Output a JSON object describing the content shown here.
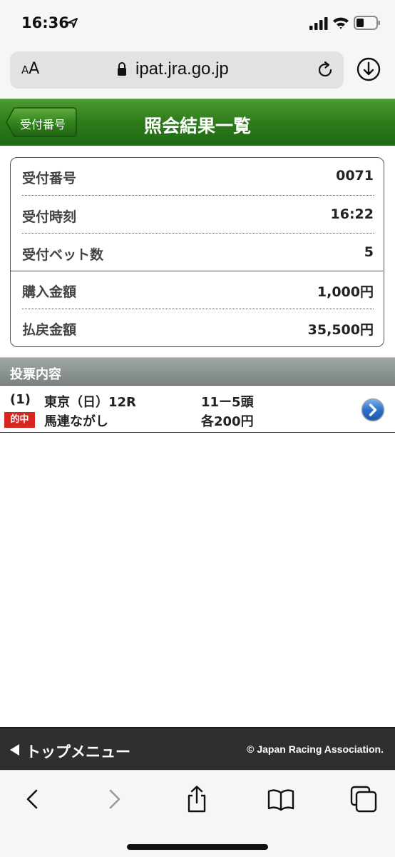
{
  "status_bar": {
    "time": "16:36",
    "icons": [
      "location-arrow-icon",
      "signal-icon",
      "wifi-icon",
      "battery-icon"
    ]
  },
  "browser": {
    "text_size_label": "AA",
    "url": "ipat.jra.go.jp",
    "icons": [
      "lock-icon",
      "reload-icon",
      "download-icon"
    ]
  },
  "header": {
    "back_label": "受付番号",
    "title": "照会結果一覧",
    "brand_color": "#2d7a1b"
  },
  "summary": {
    "rows": [
      {
        "label": "受付番号",
        "value": "0071"
      },
      {
        "label": "受付時刻",
        "value": "16:22"
      },
      {
        "label": "受付ベット数",
        "value": "5"
      },
      {
        "label": "購入金額",
        "value": "1,000円"
      },
      {
        "label": "払戻金額",
        "value": "35,500円"
      }
    ]
  },
  "section": {
    "title": "投票内容"
  },
  "bets": [
    {
      "index": "(1)",
      "race": "東京（日）12R",
      "horses": "11ー5頭",
      "badge": "的中",
      "bet_type": "馬連ながし",
      "amount": "各200円",
      "badge_color": "#d7261e"
    }
  ],
  "footer": {
    "top_menu_label": "トップメニュー",
    "copyright": "© Japan Racing Association."
  },
  "toolbar": {
    "icons": [
      "back-arrow-icon",
      "forward-arrow-icon",
      "share-icon",
      "bookmarks-icon",
      "tabs-icon"
    ]
  }
}
